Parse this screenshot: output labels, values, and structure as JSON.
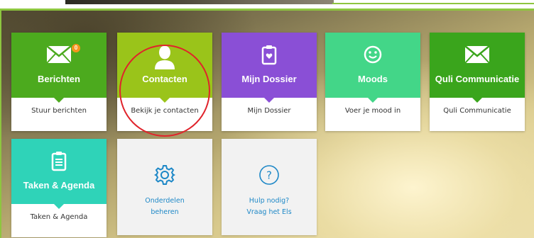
{
  "tiles": [
    {
      "title": "Berichten",
      "subtitle": "Stuur berichten",
      "icon": "envelope-icon",
      "color": "#4caa1e",
      "badge": "0"
    },
    {
      "title": "Contacten",
      "subtitle": "Bekijk je contacten",
      "icon": "person-icon",
      "color": "#9ac41a"
    },
    {
      "title": "Mijn Dossier",
      "subtitle": "Mijn Dossier",
      "icon": "dossier-icon",
      "color": "#8a4fd6"
    },
    {
      "title": "Moods",
      "subtitle": "Voer je mood in",
      "icon": "smiley-icon",
      "color": "#43d688"
    },
    {
      "title": "Quli Communicatie",
      "subtitle": "Quli Communicatie",
      "icon": "envelope-icon",
      "color": "#3aa51c"
    },
    {
      "title": "Taken & Agenda",
      "subtitle": "Taken & Agenda",
      "icon": "clipboard-icon",
      "color": "#2fd3b8"
    }
  ],
  "plain_tiles": [
    {
      "line1": "Onderdelen",
      "line2": "beheren",
      "icon": "gear-icon"
    },
    {
      "line1": "Hulp nodig?",
      "line2": "Vraag het Els",
      "icon": "help-icon"
    }
  ],
  "colors": {
    "accent": "#8dc63f",
    "link": "#1e88c7",
    "annotation": "#e0232b"
  }
}
